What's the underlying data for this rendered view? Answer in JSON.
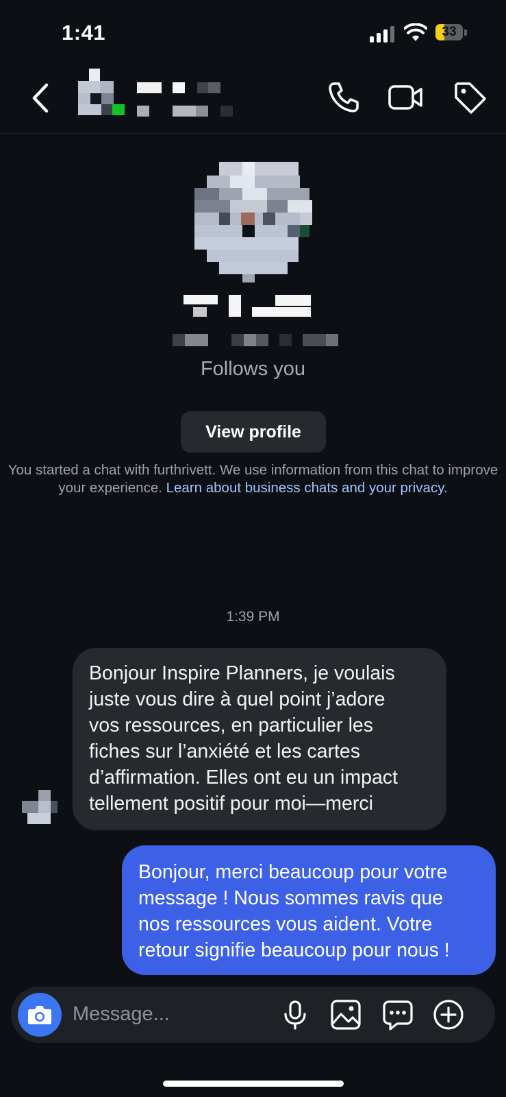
{
  "status_bar": {
    "time": "1:41",
    "battery_text": "33",
    "battery_level": 0.33
  },
  "header": {
    "icons": [
      "back-arrow-icon",
      "phone-icon",
      "video-camera-icon",
      "tag-icon"
    ]
  },
  "profile": {
    "follows_text": "Follows you",
    "view_profile_label": "View profile"
  },
  "notice": {
    "text": "You started a chat with furthrivett. We use information from this chat to improve your experience. ",
    "link": "Learn about business chats and your privacy",
    "after_link": "."
  },
  "conversation": {
    "timestamp": "1:39 PM",
    "messages": [
      {
        "direction": "incoming",
        "lines": [
          "Bonjour Inspire Planners, je voulais",
          "juste vous dire à quel point j’adore",
          "vos ressources, en particulier les",
          "fiches sur l’anxiété et les cartes",
          "d’affirmation. Elles ont eu un impact",
          "tellement positif pour moi—merci"
        ]
      },
      {
        "direction": "outgoing",
        "lines": [
          "Bonjour, merci beaucoup pour votre",
          "message ! Nous sommes ravis que",
          "nos ressources vous aident. Votre",
          "retour signifie beaucoup pour nous !"
        ]
      }
    ]
  },
  "composer": {
    "placeholder": "Message...",
    "icons": [
      "camera-icon",
      "microphone-icon",
      "gallery-icon",
      "sticker-icon",
      "plus-icon"
    ]
  },
  "colors": {
    "background": "#0c1014",
    "incoming_bubble": "#262a2f",
    "outgoing_bubble": "#3c61e6",
    "camera_button": "#3a76f0",
    "link": "#9fc3ff"
  }
}
